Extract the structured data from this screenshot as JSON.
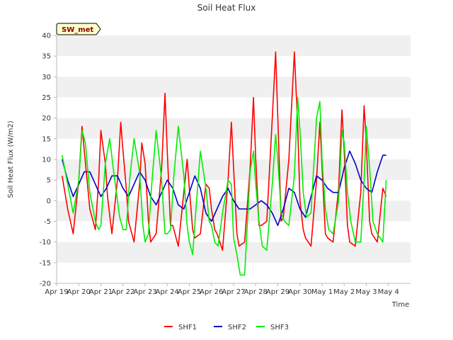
{
  "chart_data": {
    "type": "line",
    "title": "Soil Heat Flux",
    "xlabel": "Time",
    "ylabel": "Soil Heat Flux (W/m2)",
    "site_tag": "SW_met",
    "ylim": [
      -20,
      40
    ],
    "y_ticks": [
      -20,
      -15,
      -10,
      -5,
      0,
      5,
      10,
      15,
      20,
      25,
      30,
      35,
      40
    ],
    "x_ticks": [
      "Apr 19",
      "Apr 20",
      "Apr 21",
      "Apr 22",
      "Apr 23",
      "Apr 24",
      "Apr 25",
      "Apr 26",
      "Apr 27",
      "Apr 28",
      "Apr 29",
      "Apr 30",
      "May 1",
      "May 2",
      "May 3",
      "May 4"
    ],
    "x_unit": "days since Apr 19 00:00",
    "xlim": [
      0,
      16
    ],
    "grid": "horizontal bands",
    "legend_position": "bottom",
    "series": [
      {
        "name": "SHF1",
        "color": "#ff0000",
        "x": [
          0.25,
          0.5,
          0.75,
          1.0,
          1.15,
          1.25,
          1.5,
          1.75,
          1.9,
          2.0,
          2.2,
          2.3,
          2.5,
          2.75,
          2.9,
          3.0,
          3.15,
          3.25,
          3.5,
          3.75,
          3.85,
          4.0,
          4.15,
          4.25,
          4.5,
          4.75,
          4.9,
          5.0,
          5.15,
          5.25,
          5.5,
          5.75,
          5.9,
          6.0,
          6.15,
          6.25,
          6.5,
          6.75,
          6.9,
          7.0,
          7.15,
          7.25,
          7.5,
          7.75,
          7.9,
          8.0,
          8.15,
          8.25,
          8.5,
          8.75,
          8.9,
          9.0,
          9.15,
          9.25,
          9.5,
          9.75,
          9.9,
          10.0,
          10.15,
          10.25,
          10.5,
          10.75,
          10.9,
          11.0,
          11.15,
          11.25,
          11.5,
          11.75,
          11.9,
          12.0,
          12.15,
          12.25,
          12.5,
          12.75,
          12.9,
          13.0,
          13.15,
          13.25,
          13.5,
          13.75,
          13.9,
          14.0,
          14.15,
          14.25,
          14.5,
          14.75,
          14.9
        ],
        "y": [
          6,
          -2,
          -8,
          5,
          18,
          12,
          -2,
          -7,
          5,
          17,
          9,
          1,
          -8,
          5,
          19,
          12,
          3,
          -5,
          -10,
          4,
          14,
          9,
          -5,
          -10,
          -8,
          8,
          26,
          12,
          -6,
          -6,
          -11,
          2,
          10,
          3,
          -7,
          -9,
          -8,
          4,
          3,
          -2,
          -7,
          -8,
          -12,
          5,
          19,
          8,
          -8,
          -11,
          -10,
          8,
          25,
          10,
          -6,
          -6,
          -5,
          20,
          36,
          20,
          -5,
          -4,
          10,
          36,
          18,
          0,
          -7,
          -9,
          -11,
          5,
          19,
          8,
          -8,
          -9,
          -10,
          3,
          22,
          12,
          -6,
          -10,
          -11,
          2,
          23,
          14,
          -5,
          -8,
          -10,
          3,
          1
        ]
      },
      {
        "name": "SHF2",
        "color": "#0000cd",
        "x": [
          0.25,
          0.5,
          0.75,
          1.0,
          1.25,
          1.5,
          1.75,
          2.0,
          2.25,
          2.5,
          2.75,
          3.0,
          3.25,
          3.5,
          3.75,
          4.0,
          4.25,
          4.5,
          4.75,
          5.0,
          5.25,
          5.5,
          5.75,
          6.0,
          6.25,
          6.5,
          6.75,
          7.0,
          7.25,
          7.5,
          7.75,
          8.0,
          8.25,
          8.5,
          8.75,
          9.0,
          9.25,
          9.5,
          9.75,
          10.0,
          10.25,
          10.5,
          10.75,
          11.0,
          11.25,
          11.5,
          11.75,
          12.0,
          12.25,
          12.5,
          12.75,
          13.0,
          13.25,
          13.5,
          13.75,
          14.0,
          14.25,
          14.5,
          14.75,
          14.9
        ],
        "y": [
          10,
          5,
          1,
          4,
          7,
          7,
          4,
          1,
          3,
          6,
          6,
          3,
          1,
          4,
          7,
          5,
          1,
          -1,
          2,
          5,
          3,
          -1,
          -2,
          2,
          6,
          3,
          -3,
          -5,
          -2,
          1,
          3,
          0,
          -2,
          -2,
          -2,
          -1,
          0,
          -1,
          -3,
          -6,
          -2,
          3,
          2,
          -2,
          -4,
          1,
          6,
          5,
          3,
          2,
          2,
          8,
          12,
          9,
          5,
          3,
          2,
          7,
          11,
          11
        ]
      },
      {
        "name": "SHF3",
        "color": "#00ee00",
        "x": [
          0.25,
          0.5,
          0.75,
          1.0,
          1.15,
          1.3,
          1.5,
          1.75,
          1.9,
          2.0,
          2.2,
          2.4,
          2.6,
          2.85,
          3.0,
          3.15,
          3.3,
          3.5,
          3.75,
          3.9,
          4.0,
          4.15,
          4.3,
          4.5,
          4.75,
          4.9,
          5.0,
          5.15,
          5.3,
          5.5,
          5.75,
          5.9,
          6.0,
          6.15,
          6.3,
          6.5,
          6.75,
          6.9,
          7.0,
          7.15,
          7.3,
          7.5,
          7.75,
          7.9,
          8.0,
          8.15,
          8.3,
          8.5,
          8.75,
          8.9,
          9.0,
          9.15,
          9.3,
          9.5,
          9.75,
          9.9,
          10.0,
          10.15,
          10.3,
          10.5,
          10.75,
          10.9,
          11.0,
          11.15,
          11.3,
          11.5,
          11.75,
          11.9,
          12.0,
          12.15,
          12.3,
          12.5,
          12.75,
          12.9,
          13.0,
          13.15,
          13.3,
          13.5,
          13.75,
          13.9,
          14.0,
          14.15,
          14.3,
          14.5,
          14.75,
          14.9
        ],
        "y": [
          11,
          4,
          -3,
          5,
          17,
          14,
          2,
          -5,
          -7,
          -6,
          9,
          15,
          6,
          -4,
          -7,
          -7,
          5,
          15,
          7,
          -6,
          -10,
          -8,
          4,
          17,
          5,
          -8,
          -8,
          -7,
          6,
          18,
          6,
          -6,
          -10,
          -13,
          -2,
          12,
          3,
          -5,
          -6,
          -10,
          -11,
          -3,
          5,
          4,
          -9,
          -13,
          -18,
          -18,
          7,
          12,
          4,
          -5,
          -11,
          -12,
          4,
          16,
          10,
          -3,
          -5,
          -6,
          6,
          25,
          17,
          2,
          -4,
          -3,
          20,
          24,
          10,
          -2,
          -7,
          -8,
          0,
          17,
          14,
          2,
          -5,
          -10,
          -10,
          5,
          18,
          8,
          -5,
          -8,
          -10,
          5
        ]
      }
    ]
  }
}
